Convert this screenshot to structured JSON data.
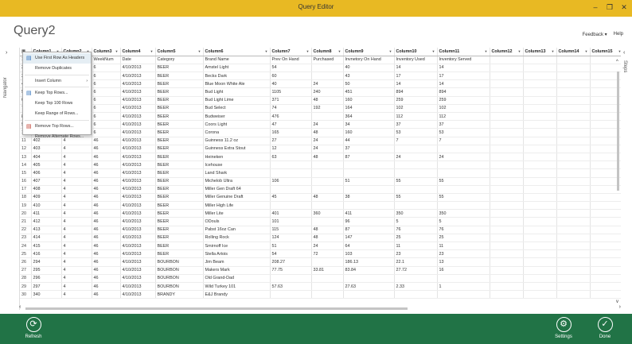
{
  "window": {
    "title": "Query Editor",
    "controls": [
      "–",
      "❐",
      "✕"
    ]
  },
  "query_title": "Query2",
  "header_links": {
    "feedback": "Feedback ▾",
    "help": "Help"
  },
  "navigator_label": "Navigator",
  "steps_label": "Steps",
  "columns": [
    "Column1",
    "Column2",
    "Column3",
    "Column4",
    "Column5",
    "Column6",
    "Column7",
    "Column8",
    "Column9",
    "Column10",
    "Column11",
    "Column12",
    "Column13",
    "Column14",
    "Column15",
    "Colu"
  ],
  "rows": [
    [
      "1",
      "",
      "",
      "WeekNum",
      "Date",
      "Category",
      "Brand Name",
      "Prev On Hand",
      "Purchased",
      "Invnetory On Hand",
      "Inventory Used",
      "Inventory Served",
      "",
      "",
      "",
      ""
    ],
    [
      "2",
      "",
      "",
      "6",
      "4/10/2013",
      "BEER",
      "Amstel Light",
      "54",
      "",
      "40",
      "14",
      "14",
      "",
      "",
      "",
      ""
    ],
    [
      "3",
      "",
      "",
      "6",
      "4/10/2013",
      "BEER",
      "Becks Dark",
      "60",
      "",
      "43",
      "17",
      "17",
      "",
      "",
      "",
      ""
    ],
    [
      "4",
      "",
      "",
      "6",
      "4/10/2013",
      "BEER",
      "Blue Moon White Ale",
      "40",
      "24",
      "50",
      "14",
      "14",
      "",
      "",
      "",
      ""
    ],
    [
      "5",
      "",
      "",
      "6",
      "4/10/2013",
      "BEER",
      "Bud Light",
      "1105",
      "240",
      "451",
      "894",
      "894",
      "",
      "",
      "",
      ""
    ],
    [
      "6",
      "",
      "",
      "6",
      "4/10/2013",
      "BEER",
      "Bud Light Lime",
      "371",
      "48",
      "160",
      "259",
      "259",
      "",
      "",
      "",
      ""
    ],
    [
      "7",
      "",
      "",
      "6",
      "4/10/2013",
      "BEER",
      "Bud Select",
      "74",
      "192",
      "164",
      "102",
      "102",
      "",
      "",
      "",
      ""
    ],
    [
      "8",
      "",
      "",
      "6",
      "4/10/2013",
      "BEER",
      "Budweiser",
      "476",
      "",
      "364",
      "112",
      "112",
      "",
      "",
      "",
      ""
    ],
    [
      "9",
      "",
      "",
      "6",
      "4/10/2013",
      "BEER",
      "Coors Light",
      "47",
      "24",
      "34",
      "37",
      "37",
      "",
      "",
      "",
      ""
    ],
    [
      "10",
      "",
      "",
      "6",
      "4/10/2013",
      "BEER",
      "Corona",
      "165",
      "48",
      "160",
      "53",
      "53",
      "",
      "",
      "",
      ""
    ],
    [
      "11",
      "402",
      "4",
      "46",
      "4/10/2013",
      "BEER",
      "Guinness 11.2 oz",
      "27",
      "24",
      "44",
      "7",
      "7",
      "",
      "",
      "",
      ""
    ],
    [
      "12",
      "403",
      "4",
      "46",
      "4/10/2013",
      "BEER",
      "Guinness Extra Stout",
      "12",
      "24",
      "37",
      "",
      "",
      "",
      "",
      "",
      ""
    ],
    [
      "13",
      "404",
      "4",
      "46",
      "4/10/2013",
      "BEER",
      "Heineken",
      "63",
      "48",
      "87",
      "24",
      "24",
      "",
      "",
      "",
      ""
    ],
    [
      "14",
      "405",
      "4",
      "46",
      "4/10/2013",
      "BEER",
      "Icehouse",
      "",
      "",
      "",
      "",
      "",
      "",
      "",
      "",
      ""
    ],
    [
      "15",
      "406",
      "4",
      "46",
      "4/10/2013",
      "BEER",
      "Land Shark",
      "",
      "",
      "",
      "",
      "",
      "",
      "",
      "",
      ""
    ],
    [
      "16",
      "407",
      "4",
      "46",
      "4/10/2013",
      "BEER",
      "Michelob Ultra",
      "106",
      "",
      "51",
      "55",
      "55",
      "",
      "",
      "",
      ""
    ],
    [
      "17",
      "408",
      "4",
      "46",
      "4/10/2013",
      "BEER",
      "Miller Gen Draft 64",
      "",
      "",
      "",
      "",
      "",
      "",
      "",
      "",
      ""
    ],
    [
      "18",
      "409",
      "4",
      "46",
      "4/10/2013",
      "BEER",
      "Miller Genuine Draft",
      "45",
      "48",
      "38",
      "55",
      "55",
      "",
      "",
      "",
      ""
    ],
    [
      "19",
      "410",
      "4",
      "46",
      "4/10/2013",
      "BEER",
      "Miller High Life",
      "",
      "",
      "",
      "",
      "",
      "",
      "",
      "",
      ""
    ],
    [
      "20",
      "411",
      "4",
      "46",
      "4/10/2013",
      "BEER",
      "Miller Lite",
      "401",
      "360",
      "411",
      "350",
      "350",
      "",
      "",
      "",
      ""
    ],
    [
      "21",
      "412",
      "4",
      "46",
      "4/10/2013",
      "BEER",
      "ODouls",
      "101",
      "",
      "96",
      "5",
      "5",
      "",
      "",
      "",
      ""
    ],
    [
      "22",
      "413",
      "4",
      "46",
      "4/10/2013",
      "BEER",
      "Pabst 16oz Can",
      "115",
      "48",
      "87",
      "76",
      "76",
      "",
      "",
      "",
      ""
    ],
    [
      "23",
      "414",
      "4",
      "46",
      "4/10/2013",
      "BEER",
      "Rolling Rock",
      "124",
      "48",
      "147",
      "25",
      "25",
      "",
      "",
      "",
      ""
    ],
    [
      "24",
      "415",
      "4",
      "46",
      "4/10/2013",
      "BEER",
      "Smirnoff Ice",
      "51",
      "24",
      "64",
      "11",
      "11",
      "",
      "",
      "",
      ""
    ],
    [
      "25",
      "416",
      "4",
      "46",
      "4/10/2013",
      "BEER",
      "Stella Artois",
      "54",
      "72",
      "103",
      "23",
      "23",
      "",
      "",
      "",
      ""
    ],
    [
      "26",
      "294",
      "4",
      "46",
      "4/10/2013",
      "BOURBON",
      "Jim Beam",
      "208.27",
      "",
      "186.13",
      "22.1",
      "13",
      "",
      "",
      "",
      ""
    ],
    [
      "27",
      "295",
      "4",
      "46",
      "4/10/2013",
      "BOURBON",
      "Makers Mark",
      "77.75",
      "33.81",
      "83.84",
      "27.72",
      "16",
      "",
      "",
      "",
      ""
    ],
    [
      "28",
      "296",
      "4",
      "46",
      "4/10/2013",
      "BOURBON",
      "Old Grand-Dad",
      "",
      "",
      "",
      "",
      "",
      "",
      "",
      "",
      ""
    ],
    [
      "29",
      "297",
      "4",
      "46",
      "4/10/2013",
      "BOURBON",
      "Wild Turkey 101",
      "57.63",
      "",
      "27.63",
      "2.33",
      "1",
      "",
      "",
      "",
      ""
    ],
    [
      "30",
      "340",
      "4",
      "46",
      "4/10/2013",
      "BRANDY",
      "E&J Brandy",
      "",
      "",
      "",
      "",
      "",
      "",
      "",
      "",
      ""
    ]
  ],
  "context_menu": [
    {
      "label": "Use First Row As Headers",
      "icon": "table-header-icon",
      "selected": true
    },
    {
      "label": "Remove Duplicates",
      "icon": "",
      "selected": false
    },
    {
      "sep": true
    },
    {
      "label": "Insert Column",
      "icon": "",
      "submenu": true
    },
    {
      "sep": true
    },
    {
      "label": "Keep Top Rows...",
      "icon": "keep-rows-icon"
    },
    {
      "label": "Keep Top 100 Rows",
      "icon": ""
    },
    {
      "label": "Keep Range of Rows...",
      "icon": ""
    },
    {
      "sep": true
    },
    {
      "label": "Remove Top Rows...",
      "icon": "remove-rows-icon"
    },
    {
      "label": "Remove Alternate Rows...",
      "icon": ""
    }
  ],
  "app_bar": {
    "refresh": "Refresh",
    "settings": "Settings",
    "done": "Done"
  },
  "colors": {
    "title_bar": "#e8b923",
    "app_bar": "#217346"
  }
}
